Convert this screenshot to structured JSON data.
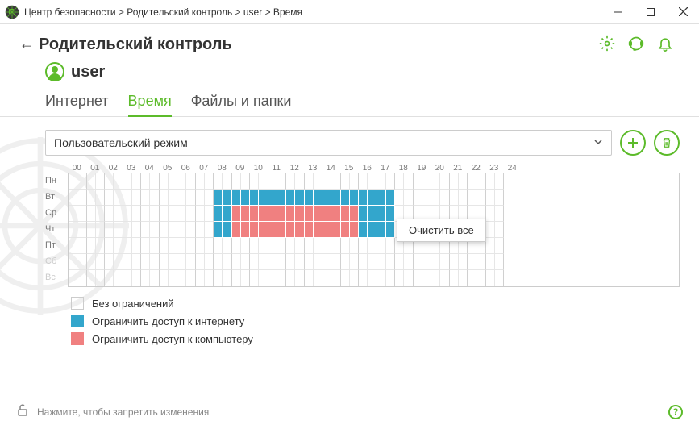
{
  "titlebar": {
    "breadcrumb": "Центр безопасности > Родительский контроль > user > Время"
  },
  "header": {
    "title": "Родительский контроль"
  },
  "user": {
    "name": "user"
  },
  "tabs": [
    {
      "label": "Интернет",
      "active": false
    },
    {
      "label": "Время",
      "active": true
    },
    {
      "label": "Файлы и папки",
      "active": false
    }
  ],
  "mode": {
    "selected": "Пользовательский режим"
  },
  "schedule": {
    "hours": [
      "00",
      "01",
      "02",
      "03",
      "04",
      "05",
      "06",
      "07",
      "08",
      "09",
      "10",
      "11",
      "12",
      "13",
      "14",
      "15",
      "16",
      "17",
      "18",
      "19",
      "20",
      "21",
      "22",
      "23",
      "24"
    ],
    "days": [
      {
        "label": "Пн",
        "weekend": false,
        "cells": []
      },
      {
        "label": "Вт",
        "weekend": false,
        "cells": [
          {
            "from": 16,
            "to": 36,
            "kind": "blue"
          }
        ]
      },
      {
        "label": "Ср",
        "weekend": false,
        "cells": [
          {
            "from": 16,
            "to": 18,
            "kind": "blue"
          },
          {
            "from": 18,
            "to": 32,
            "kind": "red"
          },
          {
            "from": 32,
            "to": 36,
            "kind": "blue"
          }
        ]
      },
      {
        "label": "Чт",
        "weekend": false,
        "cells": [
          {
            "from": 16,
            "to": 18,
            "kind": "blue"
          },
          {
            "from": 18,
            "to": 32,
            "kind": "red"
          },
          {
            "from": 32,
            "to": 36,
            "kind": "blue"
          }
        ]
      },
      {
        "label": "Пт",
        "weekend": false,
        "cells": []
      },
      {
        "label": "Сб",
        "weekend": true,
        "cells": []
      },
      {
        "label": "Вс",
        "weekend": true,
        "cells": []
      }
    ]
  },
  "context_menu": {
    "item": "Очистить все"
  },
  "legend": {
    "none": "Без ограничений",
    "internet": "Ограничить доступ к интернету",
    "computer": "Ограничить доступ к компьютеру"
  },
  "footer": {
    "lock_hint": "Нажмите, чтобы запретить изменения"
  },
  "colors": {
    "accent": "#5CBB2A",
    "internet_restrict": "#33A6CC",
    "computer_restrict": "#F08080"
  }
}
